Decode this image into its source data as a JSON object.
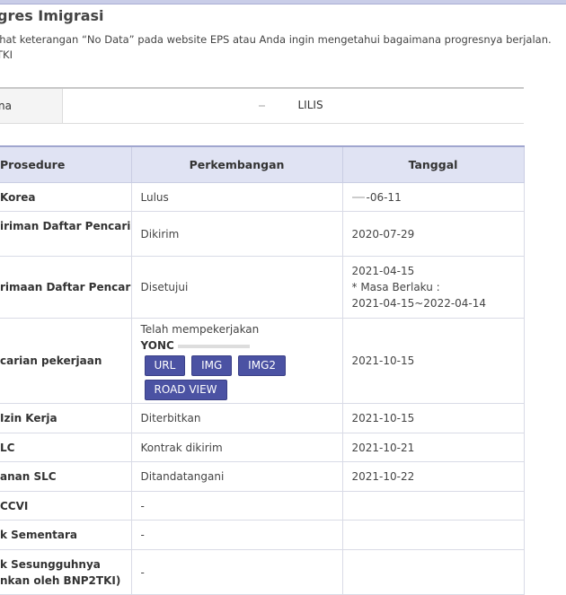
{
  "header": {
    "title": "ogres Imigrasi",
    "desc_line1": "ihat keterangan “No Data” pada website EPS atau Anda ingin mengetahui bagaimana progresnya berjalan.",
    "desc_line2": "TKI"
  },
  "name_row": {
    "label": "na",
    "value": "LILIS"
  },
  "table": {
    "headers": [
      "Prosedure",
      "Perkembangan",
      "Tanggal"
    ],
    "rows": [
      {
        "procedure": "Korea",
        "status": "Lulus",
        "date": "-06-11"
      },
      {
        "procedure": "iriman Daftar Pencari",
        "status": "Dikirim",
        "date": "2020-07-29"
      },
      {
        "procedure": "rimaan Daftar Pencari",
        "status": "Disetujui",
        "date": "2021-04-15",
        "date_line2": "* Masa Berlaku :",
        "date_line3": "2021-04-15~2022-04-14"
      },
      {
        "procedure": "carian pekerjaan",
        "status": "Telah mempekerjakan",
        "employer": "YONC",
        "date": "2021-10-15"
      },
      {
        "procedure": "Izin Kerja",
        "status": "Diterbitkan",
        "date": "2021-10-15"
      },
      {
        "procedure": "LC",
        "status": "Kontrak dikirim",
        "date": "2021-10-21"
      },
      {
        "procedure": "anan SLC",
        "status": "Ditandatangani",
        "date": "2021-10-22"
      },
      {
        "procedure": "CCVI",
        "status": "-",
        "date": ""
      },
      {
        "procedure": "k Sementara",
        "status": "-",
        "date": ""
      },
      {
        "procedure": "k Sesungguhnya",
        "procedure_line2": "nkan oleh BNP2TKI)",
        "status": "-",
        "date": ""
      }
    ]
  },
  "buttons": {
    "url": "URL",
    "img": "IMG",
    "img2": "IMG2",
    "road_view": "ROAD VIEW"
  },
  "colors": {
    "header_bg": "#e0e3f3",
    "button_bg": "#4b52a3",
    "top_border": "#a0a6cf"
  }
}
